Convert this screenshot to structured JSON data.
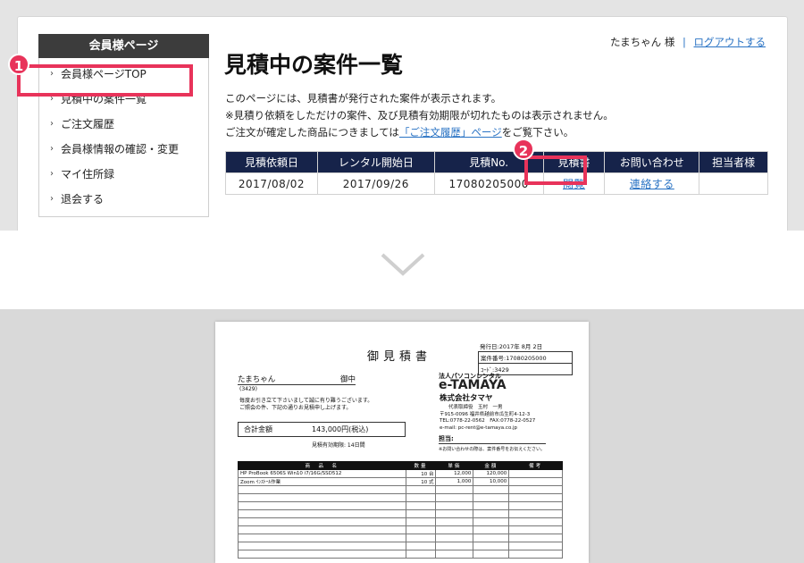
{
  "sidebar": {
    "heading": "会員様ページ",
    "items": [
      {
        "label": "会員様ページTOP"
      },
      {
        "label": "見積中の案件一覧"
      },
      {
        "label": "ご注文履歴"
      },
      {
        "label": "会員様情報の確認・変更"
      },
      {
        "label": "マイ住所録"
      },
      {
        "label": "退会する"
      }
    ]
  },
  "header": {
    "user_name": "たまちゃん",
    "honorific": "様",
    "separator": "|",
    "logout": "ログアウトする"
  },
  "page": {
    "title": "見積中の案件一覧",
    "desc_line1": "このページには、見積書が発行された案件が表示されます。",
    "desc_line2": "※見積り依頼をしただけの案件、及び見積有効期限が切れたものは表示されません。",
    "desc_line3_pre": "ご注文が確定した商品につきましては",
    "desc_line3_link": "「ご注文履歴」ページ",
    "desc_line3_post": "をご覧下さい。"
  },
  "table": {
    "headers": [
      "見積依頼日",
      "レンタル開始日",
      "見積No.",
      "見積書",
      "お問い合わせ",
      "担当者様"
    ],
    "rows": [
      {
        "request_date": "2017/08/02",
        "start_date": "2017/09/26",
        "quote_no": "17080205000",
        "view": "閲覧",
        "contact": "連絡する",
        "staff": ""
      }
    ]
  },
  "badges": {
    "one": "1",
    "two": "2"
  },
  "document": {
    "title": "御見積書",
    "issue_date": "発行日:2017年 8月 2日",
    "case_no": "案件番号:17080205000",
    "code": "ｺｰﾄﾞ:3429",
    "customer": "たまちゃん",
    "customer_suffix": "御中",
    "customer_id": "(3429)",
    "greeting1": "毎度お引き立て下さいまして誠に有り難うございます。",
    "greeting2": "ご照会の件、下記の通りお見積申し上げます。",
    "total_label": "合計金額",
    "total_value": "143,000円(税込)",
    "validity": "見積有効期限: 14日間",
    "company_label": "法人パソコンレンタル",
    "company_brand": "e-TAMAYA",
    "company_name": "株式会社タマヤ",
    "rep": "代表取締役　玉村　一男",
    "address": "〒915-0096 福井県越前市瓜生町4-12-3",
    "tel": "TEL:0778-22-0562　FAX:0778-22-0527",
    "email": "e-mail: pc-rent@e-tamaya.co.jp",
    "tanto": "担当:",
    "note": "※お問い合わせの際は、案件番号をお伝えください。",
    "table_headers": [
      "商　品　名",
      "数量",
      "単価",
      "金額",
      "備考"
    ],
    "items": [
      {
        "name": "HP ProBook 6506S Win10 i7/16G/SSD512",
        "qty": "10 台",
        "unit": "12,000",
        "amount": "120,000",
        "note": ""
      },
      {
        "name": "Zoom ｲﾝｽﾄｰﾙ作業",
        "qty": "10 式",
        "unit": "1,000",
        "amount": "10,000",
        "note": ""
      }
    ]
  },
  "colors": {
    "accent": "#e8335a",
    "table_header": "#16234a",
    "link": "#2a73c4"
  }
}
